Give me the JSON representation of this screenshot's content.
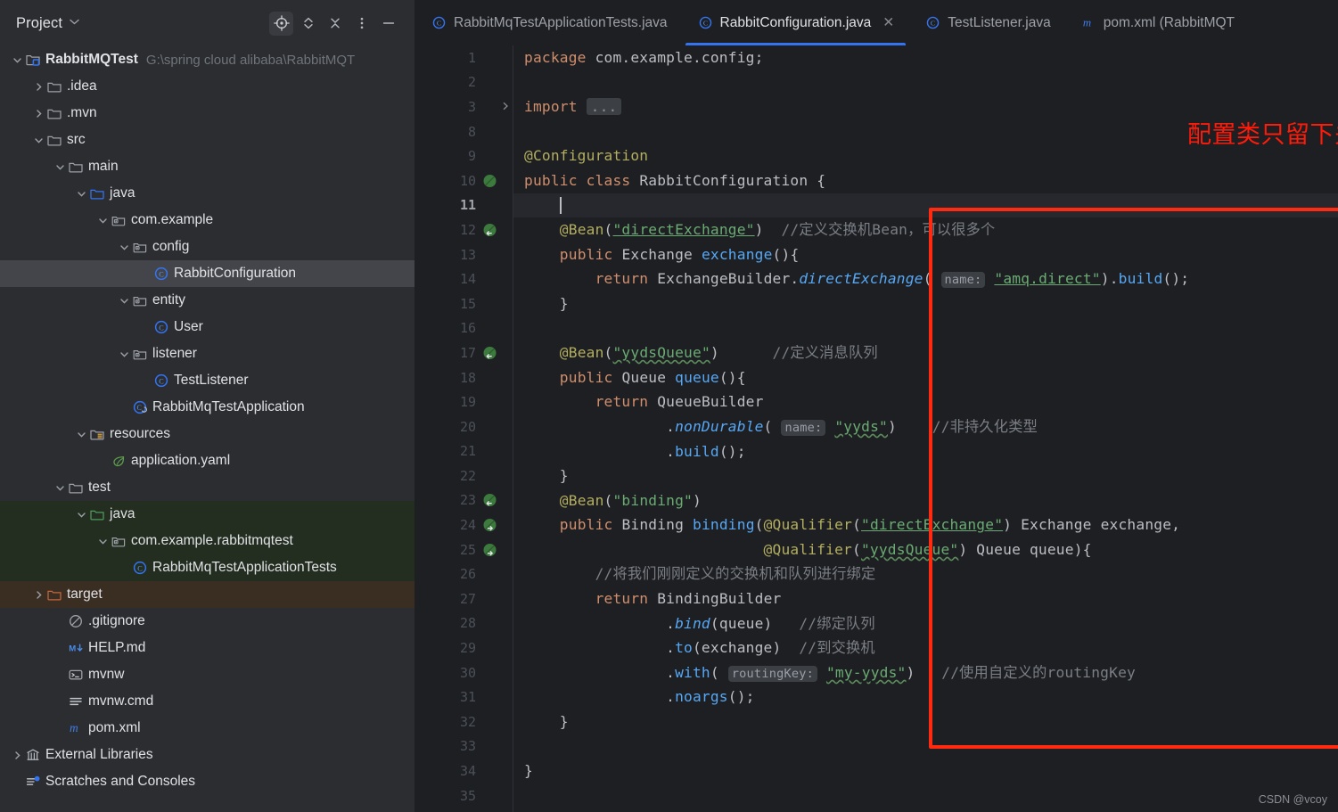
{
  "panel": {
    "title": "Project",
    "caret": "⌄",
    "tools": [
      {
        "name": "locate-file-icon",
        "label": "Select Opened File",
        "active": true
      },
      {
        "name": "expand-collapse-icon",
        "label": "Expand or Collapse",
        "active": false
      },
      {
        "name": "collapse-all-icon",
        "label": "Collapse All",
        "active": false
      },
      {
        "name": "more-options-icon",
        "label": "Options",
        "active": false
      },
      {
        "name": "hide-panel-icon",
        "label": "Hide",
        "active": false
      }
    ]
  },
  "tree": [
    {
      "indent": 0,
      "arrow": "down",
      "icon": "module-root-icon",
      "label": "RabbitMQTest",
      "bold": true,
      "sub": "G:\\spring cloud alibaba\\RabbitMQT",
      "state": "normal"
    },
    {
      "indent": 1,
      "arrow": "right",
      "icon": "folder-icon",
      "label": ".idea",
      "state": "normal"
    },
    {
      "indent": 1,
      "arrow": "right",
      "icon": "folder-icon",
      "label": ".mvn",
      "state": "normal"
    },
    {
      "indent": 1,
      "arrow": "down",
      "icon": "folder-icon",
      "label": "src",
      "state": "normal"
    },
    {
      "indent": 2,
      "arrow": "down",
      "icon": "folder-icon",
      "label": "main",
      "state": "normal"
    },
    {
      "indent": 3,
      "arrow": "down",
      "icon": "source-root-icon",
      "label": "java",
      "state": "normal"
    },
    {
      "indent": 4,
      "arrow": "down",
      "icon": "package-icon",
      "label": "com.example",
      "state": "normal"
    },
    {
      "indent": 5,
      "arrow": "down",
      "icon": "package-icon",
      "label": "config",
      "state": "normal"
    },
    {
      "indent": 6,
      "arrow": "none",
      "icon": "java-class-icon",
      "label": "RabbitConfiguration",
      "state": "selected"
    },
    {
      "indent": 5,
      "arrow": "down",
      "icon": "package-icon",
      "label": "entity",
      "state": "normal"
    },
    {
      "indent": 6,
      "arrow": "none",
      "icon": "java-class-icon",
      "label": "User",
      "state": "normal"
    },
    {
      "indent": 5,
      "arrow": "down",
      "icon": "package-icon",
      "label": "listener",
      "state": "normal"
    },
    {
      "indent": 6,
      "arrow": "none",
      "icon": "java-class-icon",
      "label": "TestListener",
      "state": "normal"
    },
    {
      "indent": 5,
      "arrow": "none",
      "icon": "spring-class-icon",
      "label": "RabbitMqTestApplication",
      "state": "normal"
    },
    {
      "indent": 3,
      "arrow": "down",
      "icon": "resource-root-icon",
      "label": "resources",
      "state": "normal"
    },
    {
      "indent": 4,
      "arrow": "none",
      "icon": "spring-yaml-icon",
      "label": "application.yaml",
      "state": "normal"
    },
    {
      "indent": 2,
      "arrow": "down",
      "icon": "folder-icon",
      "label": "test",
      "state": "normal"
    },
    {
      "indent": 3,
      "arrow": "down",
      "icon": "test-source-root-icon",
      "label": "java",
      "state": "testroot"
    },
    {
      "indent": 4,
      "arrow": "down",
      "icon": "package-icon",
      "label": "com.example.rabbitmqtest",
      "state": "testroot"
    },
    {
      "indent": 5,
      "arrow": "none",
      "icon": "java-class-icon",
      "label": "RabbitMqTestApplicationTests",
      "state": "testroot"
    },
    {
      "indent": 1,
      "arrow": "right",
      "icon": "excluded-folder-icon",
      "label": "target",
      "state": "excluded"
    },
    {
      "indent": 2,
      "arrow": "none",
      "icon": "gitignore-icon",
      "label": ".gitignore",
      "state": "normal"
    },
    {
      "indent": 2,
      "arrow": "none",
      "icon": "markdown-icon",
      "label": "HELP.md",
      "state": "normal"
    },
    {
      "indent": 2,
      "arrow": "none",
      "icon": "shell-script-icon",
      "label": "mvnw",
      "state": "normal"
    },
    {
      "indent": 2,
      "arrow": "none",
      "icon": "cmd-file-icon",
      "label": "mvnw.cmd",
      "state": "normal"
    },
    {
      "indent": 2,
      "arrow": "none",
      "icon": "maven-pom-icon",
      "label": "pom.xml",
      "state": "normal"
    },
    {
      "indent": 0,
      "arrow": "right",
      "icon": "external-libraries-icon",
      "label": "External Libraries",
      "state": "normal"
    },
    {
      "indent": 0,
      "arrow": "none",
      "icon": "scratches-icon",
      "label": "Scratches and Consoles",
      "state": "normal"
    }
  ],
  "tabs": [
    {
      "icon": "java-class-icon",
      "label": "RabbitMqTestApplicationTests.java",
      "active": false,
      "closable": false
    },
    {
      "icon": "java-class-icon",
      "label": "RabbitConfiguration.java",
      "active": true,
      "closable": true,
      "close": "✕"
    },
    {
      "icon": "java-class-icon",
      "label": "TestListener.java",
      "active": false,
      "closable": false
    },
    {
      "icon": "maven-pom-icon",
      "label": "pom.xml (RabbitMQT",
      "active": false,
      "closable": false
    }
  ],
  "editor": {
    "gutter": [
      {
        "num": "1",
        "bean": false,
        "fold": "",
        "current": false
      },
      {
        "num": "2",
        "bean": false,
        "fold": "",
        "current": false
      },
      {
        "num": "3",
        "bean": false,
        "fold": "right",
        "current": false
      },
      {
        "num": "8",
        "bean": false,
        "fold": "",
        "current": false
      },
      {
        "num": "9",
        "bean": false,
        "fold": "",
        "current": false
      },
      {
        "num": "10",
        "bean": "plain",
        "fold": "",
        "current": false
      },
      {
        "num": "11",
        "bean": false,
        "fold": "",
        "current": true
      },
      {
        "num": "12",
        "bean": "left",
        "fold": "",
        "current": false
      },
      {
        "num": "13",
        "bean": false,
        "fold": "",
        "current": false
      },
      {
        "num": "14",
        "bean": false,
        "fold": "",
        "current": false
      },
      {
        "num": "15",
        "bean": false,
        "fold": "",
        "current": false
      },
      {
        "num": "16",
        "bean": false,
        "fold": "",
        "current": false
      },
      {
        "num": "17",
        "bean": "left",
        "fold": "",
        "current": false
      },
      {
        "num": "18",
        "bean": false,
        "fold": "",
        "current": false
      },
      {
        "num": "19",
        "bean": false,
        "fold": "",
        "current": false
      },
      {
        "num": "20",
        "bean": false,
        "fold": "",
        "current": false
      },
      {
        "num": "21",
        "bean": false,
        "fold": "",
        "current": false
      },
      {
        "num": "22",
        "bean": false,
        "fold": "",
        "current": false
      },
      {
        "num": "23",
        "bean": "left",
        "fold": "",
        "current": false
      },
      {
        "num": "24",
        "bean": "right",
        "fold": "",
        "current": false
      },
      {
        "num": "25",
        "bean": "right",
        "fold": "",
        "current": false
      },
      {
        "num": "26",
        "bean": false,
        "fold": "",
        "current": false
      },
      {
        "num": "27",
        "bean": false,
        "fold": "",
        "current": false
      },
      {
        "num": "28",
        "bean": false,
        "fold": "",
        "current": false
      },
      {
        "num": "29",
        "bean": false,
        "fold": "",
        "current": false
      },
      {
        "num": "30",
        "bean": false,
        "fold": "",
        "current": false
      },
      {
        "num": "31",
        "bean": false,
        "fold": "",
        "current": false
      },
      {
        "num": "32",
        "bean": false,
        "fold": "",
        "current": false
      },
      {
        "num": "33",
        "bean": false,
        "fold": "",
        "current": false
      },
      {
        "num": "34",
        "bean": false,
        "fold": "",
        "current": false
      },
      {
        "num": "35",
        "bean": false,
        "fold": "",
        "current": false
      }
    ],
    "code_text": [
      "package com.example.config;",
      "",
      "import ...",
      "",
      "@Configuration",
      "public class RabbitConfiguration {",
      "",
      "    @Bean(\"directExchange\")  //定义交换机Bean，可以很多个",
      "    public Exchange exchange(){",
      "        return ExchangeBuilder.directExchange( name: \"amq.direct\").build();",
      "    }",
      "",
      "    @Bean(\"yydsQueue\")      //定义消息队列",
      "    public Queue queue(){",
      "        return QueueBuilder",
      "                .nonDurable( name: \"yyds\")    //非持久化类型",
      "                .build();",
      "    }",
      "    @Bean(\"binding\")",
      "    public Binding binding(@Qualifier(\"directExchange\") Exchange exchange,",
      "                           @Qualifier(\"yydsQueue\") Queue queue){",
      "        //将我们刚刚定义的交换机和队列进行绑定",
      "        return BindingBuilder",
      "                .bind(queue)   //绑定队列",
      "                .to(exchange)  //到交换机",
      "                .with( routingKey: \"my-yyds\")   //使用自定义的routingKey",
      "                .noargs();",
      "    }",
      "",
      "}",
      ""
    ]
  },
  "annotations": {
    "note": "配置类只留下关于yyds队列的",
    "note_color": "#FF1B0A",
    "box_color": "#FF2A0F",
    "watermark": "CSDN @vcoy"
  },
  "colors": {
    "panel_bg": "#2B2D30",
    "editor_bg": "#1E1F22",
    "selection": "#43454A",
    "test_root": "#232E20",
    "excluded": "#3A2D22",
    "accent": "#3574F0",
    "keyword": "#CF8E6D",
    "annotation": "#B3AE60",
    "string": "#6AAB73",
    "comment": "#7A7E85",
    "method": "#56A8F5",
    "text": "#BCBEC4"
  }
}
